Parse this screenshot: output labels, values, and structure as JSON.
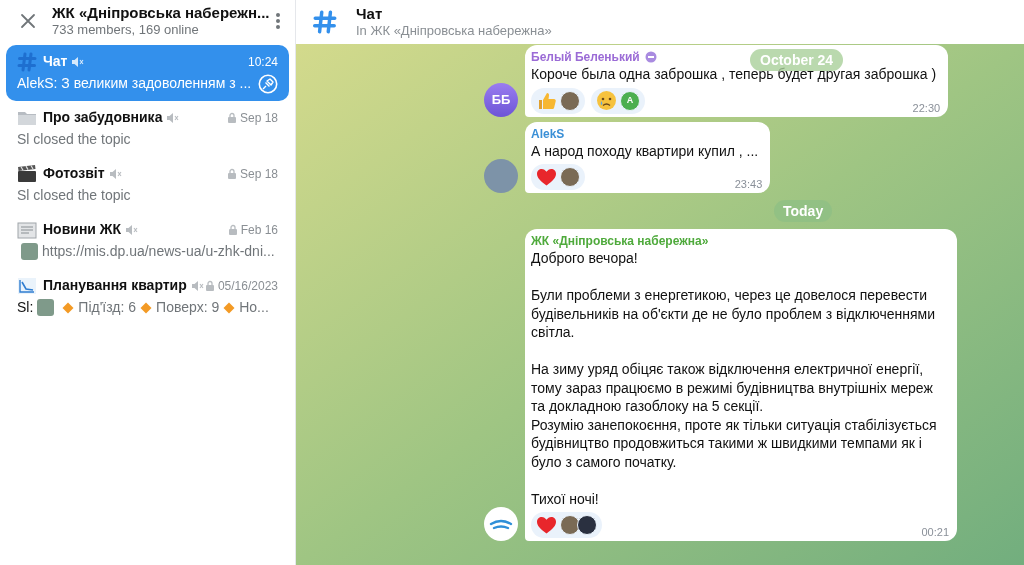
{
  "sidebar": {
    "title": "ЖК «Дніпровська набережн...",
    "subtitle": "733 members, 169 online",
    "topics": [
      {
        "kind": "hash",
        "title": "Чат",
        "muted": true,
        "closed": false,
        "time": "10:24",
        "selected": true,
        "pinned": true,
        "preview": [
          {
            "kind": "text",
            "text": "AlekS: З великим задоволенням з ..."
          }
        ]
      },
      {
        "kind": "folder",
        "title": "Про забудовника",
        "muted": true,
        "closed": true,
        "time": "Sep 18",
        "selected": false,
        "pinned": false,
        "preview": [
          {
            "kind": "text",
            "text": "Sl closed the topic"
          }
        ]
      },
      {
        "kind": "clapper",
        "title": "Фотозвіт",
        "muted": true,
        "closed": true,
        "time": "Sep 18",
        "selected": false,
        "pinned": false,
        "preview": [
          {
            "kind": "text",
            "text": "Sl closed the topic"
          }
        ]
      },
      {
        "kind": "newspaper",
        "title": "Новини ЖК",
        "muted": true,
        "closed": true,
        "time": "Feb 16",
        "selected": false,
        "pinned": false,
        "preview": [
          {
            "kind": "thumb"
          },
          {
            "kind": "text",
            "text": "https://mis.dp.ua/news-ua/u-zhk-dni..."
          }
        ]
      },
      {
        "kind": "chart",
        "title": "Планування квартир",
        "muted": true,
        "closed": true,
        "time": "05/16/2023",
        "selected": false,
        "pinned": false,
        "preview": [
          {
            "kind": "sender",
            "text": "Sl:"
          },
          {
            "kind": "thumb"
          },
          {
            "kind": "diamond"
          },
          {
            "kind": "text",
            "text": "Під'їзд: 6"
          },
          {
            "kind": "diamond"
          },
          {
            "kind": "text",
            "text": "Поверх: 9"
          },
          {
            "kind": "diamond"
          },
          {
            "kind": "text",
            "text": "Но..."
          }
        ]
      }
    ]
  },
  "chat": {
    "title": "Чат",
    "subtitle": "In ЖК «Дніпровська набережна»",
    "floating_date": "October 24",
    "items": [
      {
        "kind": "message",
        "sender": "Белый Беленький",
        "color": "#9b6bd6",
        "sender_badge": true,
        "avatar": {
          "kind": "initials",
          "text": "ББ"
        },
        "text": "Короче была одна заброшка , теперь будет другая заброшка )",
        "reactions": [
          {
            "kind": "thumbs_up",
            "users": [
              {
                "kind": "photo"
              }
            ]
          },
          {
            "kind": "crying",
            "users": [
              {
                "kind": "initials",
                "text": "A",
                "color": "#4caf50"
              }
            ]
          }
        ],
        "time": "22:30"
      },
      {
        "kind": "message",
        "sender": "AlekS",
        "color": "#3a8fd6",
        "sender_badge": false,
        "avatar": {
          "kind": "photo"
        },
        "text": "А народ походу квартири купил , ...",
        "reactions": [
          {
            "kind": "heart",
            "users": [
              {
                "kind": "photo"
              }
            ]
          }
        ],
        "time": "23:43"
      },
      {
        "kind": "date",
        "text": "Today"
      },
      {
        "kind": "message",
        "sender": "ЖК «Дніпровська набережна»",
        "color": "#4faa3c",
        "sender_badge": false,
        "avatar": {
          "kind": "logo"
        },
        "text": "Доброго вечора!\n\nБули проблеми з енергетикою, через це довелося перевести будівельників на об'єкти де не було проблем з відключеннями світла.\n\nНа зиму уряд обіцяє також відключення електричної енергії, тому зараз працюємо в режимі будівництва внутрішніх мереж та докладною газоблоку на 5 секції.\nРозумію занепокоєння, проте як тільки ситуація стабілізується будівництво продовжиться такими ж швидкими темпами як і було з самого початку.\n\nТихої ночі!",
        "reactions": [
          {
            "kind": "heart",
            "users": [
              {
                "kind": "photo"
              },
              {
                "kind": "photo_dark"
              }
            ]
          }
        ],
        "time": "00:21"
      }
    ]
  }
}
